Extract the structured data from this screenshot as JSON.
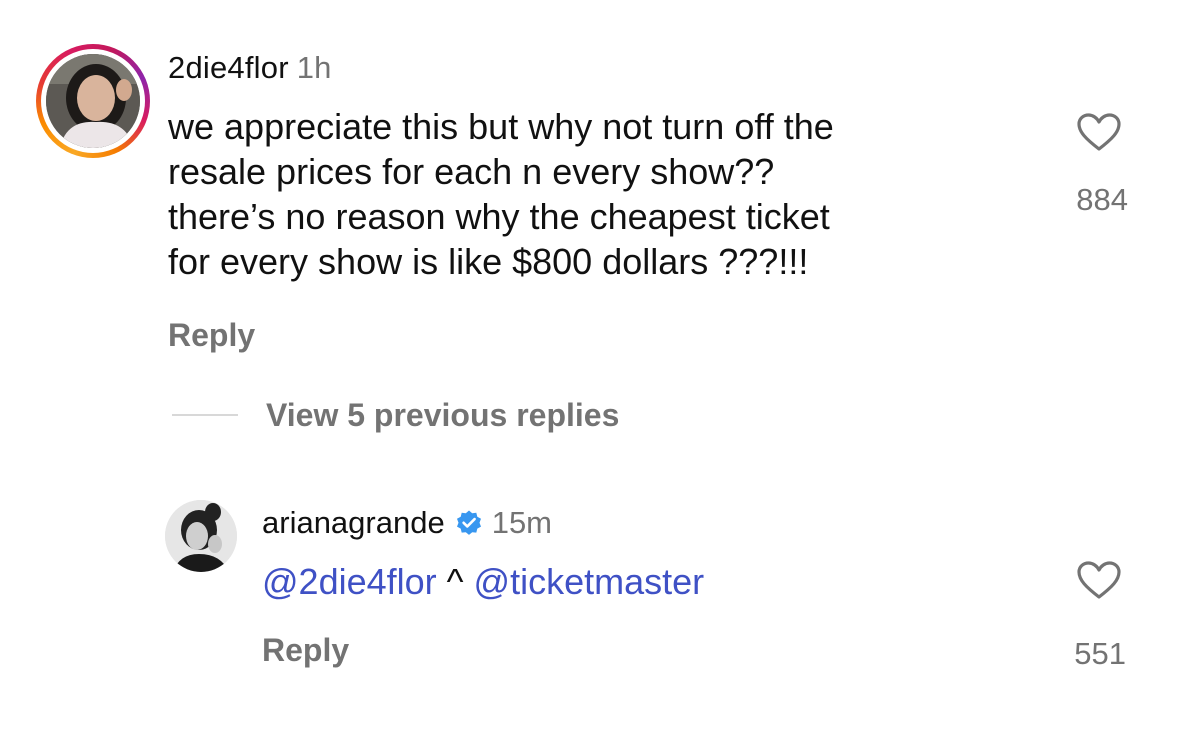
{
  "comment": {
    "username": "2die4flor",
    "time": "1h",
    "text_lines": [
      "we appreciate this but why not turn off the",
      "resale prices for each n every show??",
      "there’s no reason why the cheapest ticket",
      "for every show is like $800 dollars ???!!!"
    ],
    "reply_label": "Reply",
    "like_count": "884",
    "like_icon": "heart-outline-icon"
  },
  "view_replies": {
    "label": "View 5 previous replies"
  },
  "reply": {
    "username": "arianagrande",
    "verified_icon": "verified-badge-icon",
    "time": "15m",
    "mention1": "@2die4flor",
    "caret": "^",
    "mention2": "@ticketmaster",
    "reply_label": "Reply",
    "like_count": "551",
    "like_icon": "heart-outline-icon"
  },
  "colors": {
    "secondary_text": "#737373",
    "mention": "#3f51c5",
    "verified": "#3897f0"
  }
}
